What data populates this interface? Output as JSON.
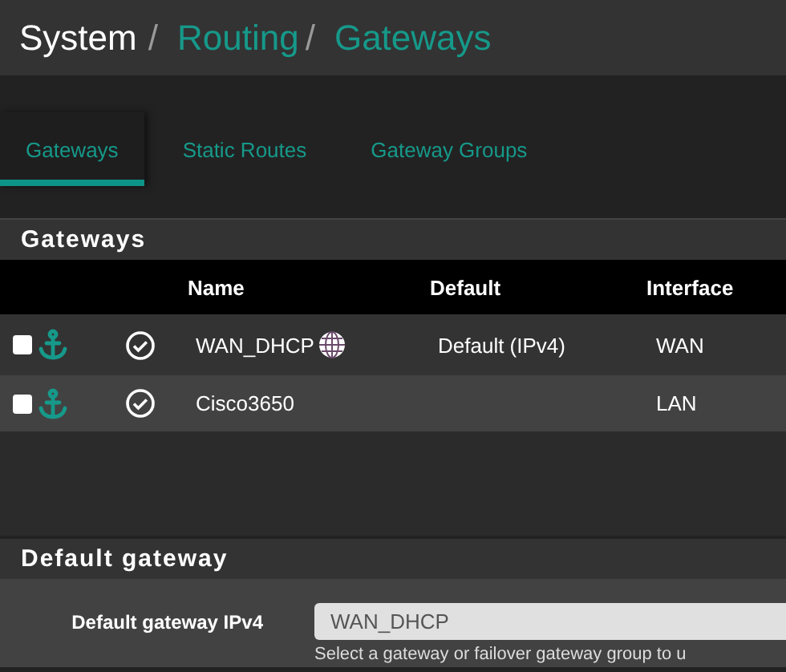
{
  "breadcrumb": [
    {
      "kind": "page",
      "label": "System"
    },
    {
      "kind": "separator",
      "label": "/"
    },
    {
      "kind": "link",
      "label": "Routing"
    },
    {
      "kind": "separator",
      "label": "/"
    },
    {
      "kind": "link",
      "label": "Gateways"
    }
  ],
  "tabs": [
    {
      "label": "Gateways",
      "selected": true
    },
    {
      "label": "Static Routes",
      "selected": false
    },
    {
      "label": "Gateway Groups",
      "selected": false
    }
  ],
  "gateways_panel": {
    "title": "Gateways",
    "columns": [
      "Name",
      "Default",
      "Interface"
    ],
    "rows": [
      {
        "selected": false,
        "name": "WAN_DHCP",
        "dynamic": true,
        "default": "Default (IPv4)",
        "interface": "WAN"
      },
      {
        "selected": false,
        "name": "Cisco3650",
        "dynamic": false,
        "interface": "LAN"
      }
    ]
  },
  "default_gateway_panel": {
    "title": "Default gateway",
    "label": "Default gateway IPv4",
    "value": "WAN_DHCP",
    "help": "Select a gateway or failover gateway group to u"
  }
}
